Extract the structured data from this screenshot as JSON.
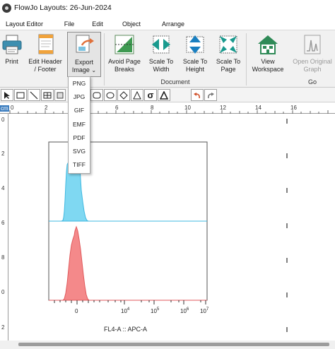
{
  "window": {
    "title": "FlowJo Layouts: 26-Jun-2024"
  },
  "menu_tabs": [
    "Layout Editor",
    "File",
    "Edit",
    "Object",
    "Arrange"
  ],
  "ribbon": {
    "print": "Print",
    "edit_header": {
      "line1": "Edit Header",
      "line2": "/ Footer"
    },
    "export_image": {
      "line1": "Export",
      "line2": "Image"
    },
    "avoid_page_breaks": {
      "line1": "Avoid Page",
      "line2": "Breaks"
    },
    "scale_to_width": {
      "line1": "Scale To",
      "line2": "Width"
    },
    "scale_to_height": {
      "line1": "Scale To",
      "line2": "Height"
    },
    "scale_to_page": {
      "line1": "Scale To",
      "line2": "Page"
    },
    "view_workspace": {
      "line1": "View",
      "line2": "Workspace"
    },
    "open_original_graph": {
      "line1": "Open Original",
      "line2": "Graph"
    },
    "groups": {
      "document": "Document",
      "go": "Go"
    }
  },
  "export_formats": [
    "PNG",
    "JPG",
    "GIF",
    "EMF",
    "PDF",
    "SVG",
    "TIFF"
  ],
  "ruler": {
    "horizontal": [
      "0",
      "2",
      "4",
      "6",
      "8",
      "10",
      "12",
      "14",
      "16"
    ],
    "vertical": [
      "0",
      "2",
      "4",
      "6",
      "8",
      "0",
      "2"
    ],
    "unit": "cm"
  },
  "plot": {
    "x_axis_label": "FL4-A :: APC-A",
    "tick_labels": {
      "zero": "0",
      "e4": "10",
      "e5": "10",
      "e6": "10",
      "e7": "10"
    },
    "tick_exponents": {
      "e4": "4",
      "e5": "5",
      "e6": "6",
      "e7": "7"
    },
    "colors": {
      "top_histogram": "#7fd8f2",
      "bottom_histogram": "#f4898a"
    }
  }
}
